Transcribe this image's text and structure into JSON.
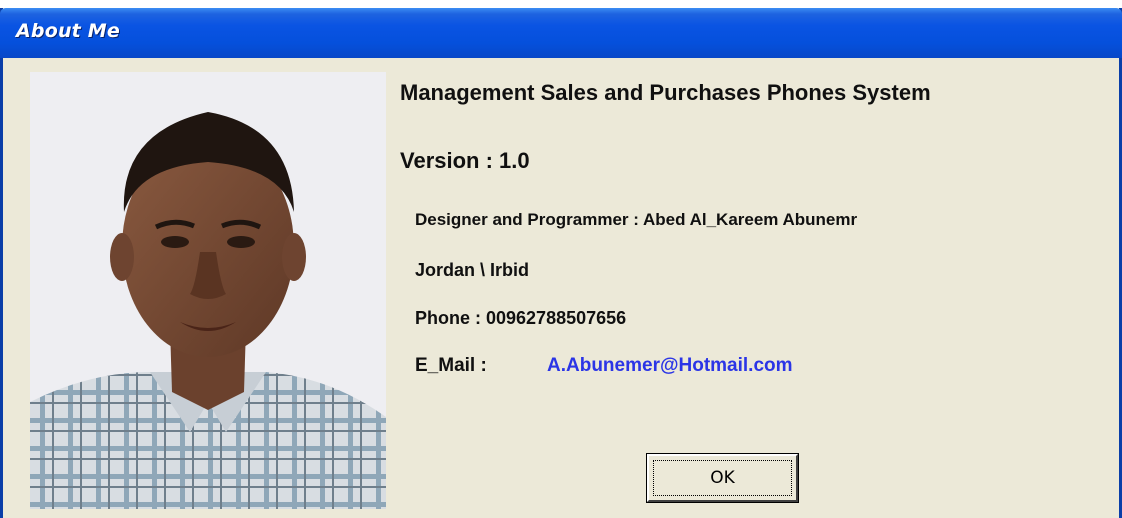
{
  "window": {
    "title": "About Me"
  },
  "about": {
    "app_title": "Management Sales and Purchases Phones System",
    "version": "Version : 1.0",
    "designer": "Designer and Programmer : Abed Al_Kareem Abunemr",
    "location": "Jordan \\ Irbid",
    "phone": "Phone : 00962788507656",
    "email_label": "E_Mail :",
    "email_value": "A.Abunemer@Hotmail.com"
  },
  "buttons": {
    "ok_label": "OK"
  },
  "colors": {
    "titlebar": "#0550dc",
    "window_bg": "#ece9d8",
    "link": "#2b35e6"
  }
}
